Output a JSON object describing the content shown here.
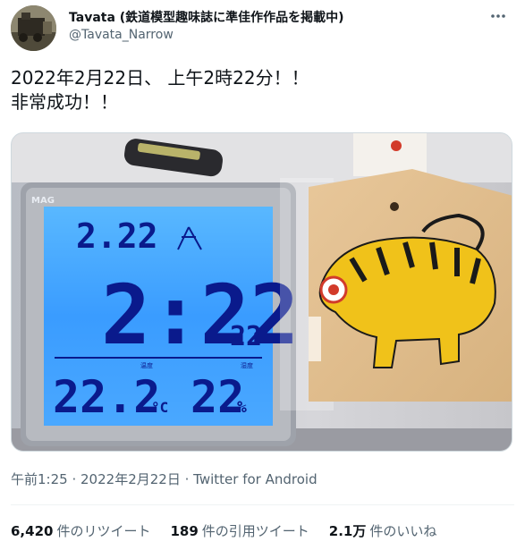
{
  "author": {
    "display_name": "Tavata (鉄道模型趣味誌に準佳作作品を掲載中)",
    "handle": "@Tavata_Narrow"
  },
  "more_icon": "more-dots-icon",
  "tweet": {
    "line1": "2022年2月22日、 上午2時22分！！",
    "line2": "非常成功！！"
  },
  "clock_display": {
    "brand": "MAG",
    "date": "2.22",
    "time_hm": "2:22",
    "seconds": "22",
    "temperature": "22.2",
    "temp_unit": "°C",
    "humidity": "22",
    "humidity_unit": "%",
    "temp_label": "温度",
    "humidity_label": "湿度"
  },
  "meta": {
    "time": "午前1:25",
    "date": "2022年2月22日",
    "source": "Twitter for Android"
  },
  "stats": {
    "retweets_count": "6,420",
    "retweets_label": "件のリツイート",
    "quotes_count": "189",
    "quotes_label": "件の引用ツイート",
    "likes_count": "2.1万",
    "likes_label": "件のいいね"
  },
  "colors": {
    "lcd_blue": "#3aa6ff",
    "lcd_digits": "#0a1a8c",
    "text_secondary": "#536471"
  }
}
